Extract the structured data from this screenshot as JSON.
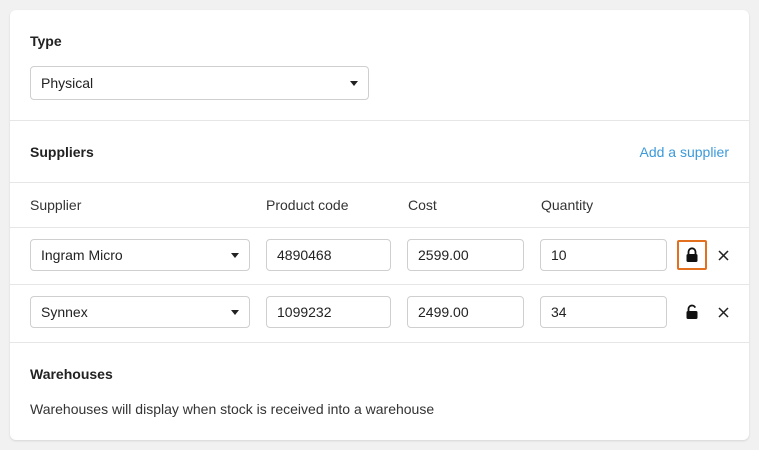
{
  "type_section": {
    "title": "Type",
    "selected": "Physical"
  },
  "suppliers_section": {
    "title": "Suppliers",
    "add_link": "Add a supplier",
    "columns": [
      "Supplier",
      "Product code",
      "Cost",
      "Quantity"
    ],
    "rows": [
      {
        "supplier": "Ingram Micro",
        "product_code": "4890468",
        "cost": "2599.00",
        "quantity": "10",
        "lock_icon": "lock-closed-icon"
      },
      {
        "supplier": "Synnex",
        "product_code": "1099232",
        "cost": "2499.00",
        "quantity": "34",
        "lock_icon": "lock-open-icon"
      }
    ]
  },
  "warehouses_section": {
    "title": "Warehouses",
    "message": "Warehouses will display when stock is received into a warehouse"
  },
  "colors": {
    "link": "#3b9ad9",
    "focus_outline": "#e2701f"
  }
}
